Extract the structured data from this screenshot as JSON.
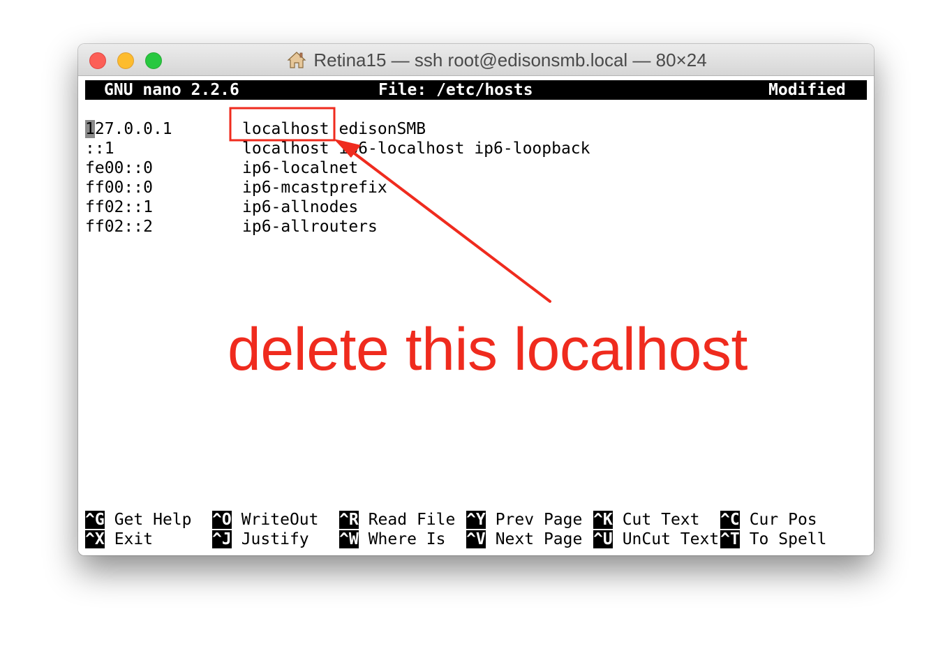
{
  "window": {
    "title": "Retina15 — ssh root@edisonsmb.local — 80×24",
    "buttons": [
      "close",
      "minimize",
      "zoom"
    ],
    "title_icon": "home-icon"
  },
  "nano": {
    "version": "GNU nano 2.2.6",
    "file": "File: /etc/hosts",
    "state": "Modified"
  },
  "hosts": [
    {
      "ip": "127.0.0.1",
      "names": "localhost edisonSMB"
    },
    {
      "ip": "::1",
      "names": "localhost ip6-localhost ip6-loopback"
    },
    {
      "ip": "fe00::0",
      "names": "ip6-localnet"
    },
    {
      "ip": "ff00::0",
      "names": "ip6-mcastprefix"
    },
    {
      "ip": "ff02::1",
      "names": "ip6-allnodes"
    },
    {
      "ip": "ff02::2",
      "names": "ip6-allrouters"
    }
  ],
  "first_line": {
    "cursor_char": "1",
    "ip_rest": "27.0.0.1",
    "highlighted_word": "localhost",
    "rest": " edisonSMB"
  },
  "shortcuts": [
    [
      {
        "key": "^G",
        "label": "Get Help"
      },
      {
        "key": "^O",
        "label": "WriteOut"
      },
      {
        "key": "^R",
        "label": "Read File"
      },
      {
        "key": "^Y",
        "label": "Prev Page"
      },
      {
        "key": "^K",
        "label": "Cut Text"
      },
      {
        "key": "^C",
        "label": "Cur Pos"
      }
    ],
    [
      {
        "key": "^X",
        "label": "Exit"
      },
      {
        "key": "^J",
        "label": "Justify"
      },
      {
        "key": "^W",
        "label": "Where Is"
      },
      {
        "key": "^V",
        "label": "Next Page"
      },
      {
        "key": "^U",
        "label": "UnCut Text"
      },
      {
        "key": "^T",
        "label": "To Spell"
      }
    ]
  ],
  "annotation": {
    "text": "delete this localhost",
    "color": "#ef2b1e"
  },
  "colors": {
    "terminal_bg": "#ffffff",
    "terminal_fg": "#000000",
    "annotation": "#ef2b1e"
  }
}
